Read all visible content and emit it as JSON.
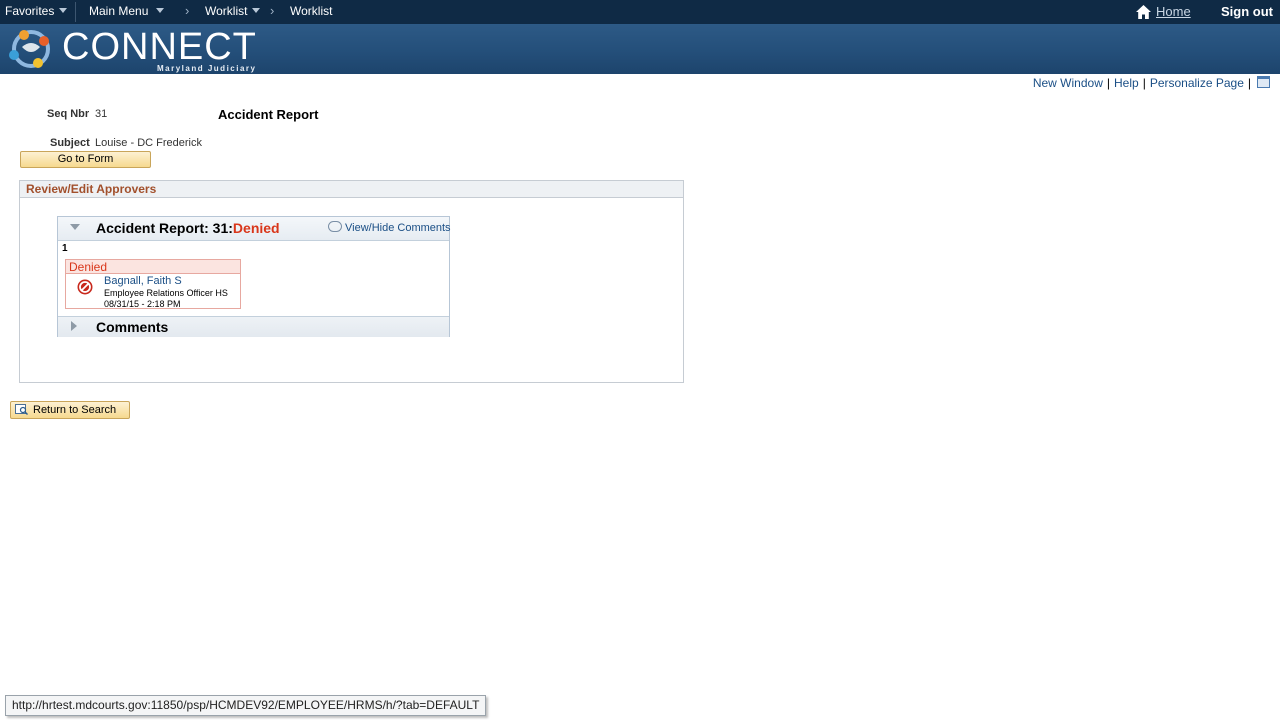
{
  "nav": {
    "favorites": "Favorites",
    "main_menu": "Main Menu",
    "worklist_menu": "Worklist",
    "worklist_crumb": "Worklist",
    "home": "Home",
    "sign_out": "Sign out"
  },
  "brand": {
    "name": "CONNECT",
    "subtitle": "Maryland Judiciary"
  },
  "page_links": {
    "new_window": "New Window",
    "help": "Help",
    "personalize": "Personalize Page"
  },
  "record": {
    "seq_label": "Seq Nbr",
    "seq_value": "31",
    "title": "Accident Report",
    "subject_label": "Subject",
    "subject_value": "Louise - DC Frederick",
    "go_to_form": "Go to Form"
  },
  "approvers": {
    "group_title": "Review/Edit Approvers",
    "header_prefix": "Accident Report: 31:",
    "header_status": "Denied",
    "view_hide_comments": "View/Hide Comments",
    "step_number": "1",
    "step_status": "Denied",
    "approver_name": "Bagnall, Faith S",
    "approver_role": "Employee Relations Officer HS",
    "approver_datetime": "08/31/15 - 2:18 PM",
    "comments_title": "Comments"
  },
  "actions": {
    "return_to_search": "Return to Search"
  },
  "status_bar": {
    "url": "http://hrtest.mdcourts.gov:11850/psp/HCMDEV92/EMPLOYEE/HRMS/h/?tab=DEFAULT"
  },
  "colors": {
    "nav_bg": "#0f2a45",
    "banner_bg": "#244f7a",
    "denied": "#d9361a",
    "link": "#1b4f86",
    "group_title": "#a2502c"
  }
}
